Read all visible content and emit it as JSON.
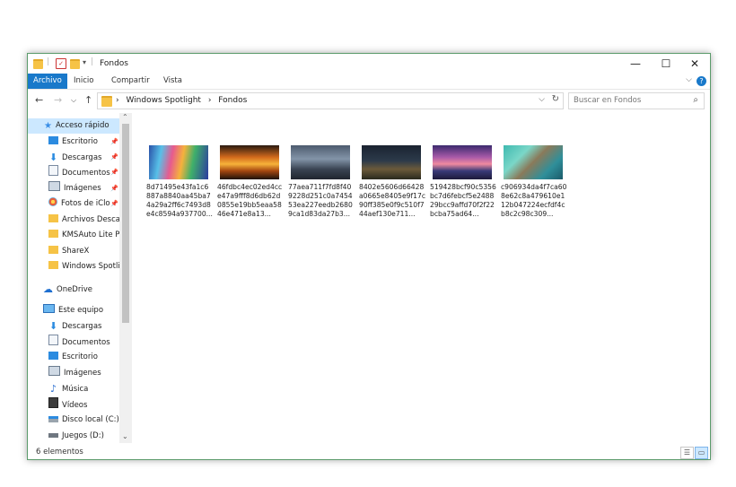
{
  "window": {
    "title": "Fondos"
  },
  "controls": {
    "minimize": "—",
    "maximize": "☐",
    "close": "✕"
  },
  "ribbon": {
    "tabs": [
      "Archivo",
      "Inicio",
      "Compartir",
      "Vista"
    ],
    "active": "Archivo",
    "help": "?"
  },
  "address": {
    "path": [
      "Windows Spotlight",
      "Fondos"
    ],
    "separator": "›"
  },
  "search": {
    "placeholder": "Buscar en Fondos"
  },
  "nav": {
    "quick_access": "Acceso rápido",
    "quick_items": [
      "Escritorio",
      "Descargas",
      "Documentos",
      "Imágenes",
      "Fotos de iClo",
      "Archivos Descar",
      "KMSAuto Lite Po",
      "ShareX",
      "Windows Spotlig"
    ],
    "onedrive": "OneDrive",
    "this_pc": "Este equipo",
    "pc_items": [
      "Descargas",
      "Documentos",
      "Escritorio",
      "Imágenes",
      "Música",
      "Vídeos",
      "Disco local (C:)",
      "Juegos (D:)"
    ]
  },
  "files": [
    {
      "name": "8d71495e43fa1c6887a8840aa45ba74a29a2ff6c7493d8e4c8594a937700..."
    },
    {
      "name": "46fdbc4ec02ed4cce47a9fff8d6db62d0855e19bb5eaa5846e471e8a13..."
    },
    {
      "name": "77aea711f7fd8f409228d251c0a745453ea227eedb26809ca1d83da27b3..."
    },
    {
      "name": "8402e5606d66428a0665e8405e9f17c90ff385e0f9c510f744aef130e711..."
    },
    {
      "name": "519428bcf90c5356bc7d6febcf5e248829bcc9affd70f2f22bcba75ad64..."
    },
    {
      "name": "c906934da4f7ca608e62c8a479610e112b047224ecfdf4cb8c2c98c309..."
    }
  ],
  "status": {
    "count": "6 elementos"
  },
  "colors": {
    "accent": "#1979ca",
    "selected": "#cce8ff",
    "border": "#5b9b6b",
    "folder": "#f6c346"
  }
}
